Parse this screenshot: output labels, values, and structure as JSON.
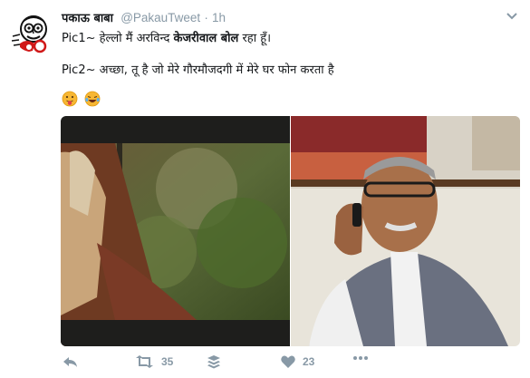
{
  "tweet": {
    "display_name": "पकाऊ बाबा",
    "handle": "@PakauTweet",
    "separator": "·",
    "time": "1h",
    "line1_before": "Pic1~ हेल्लो मैं अरविन्द ",
    "line1_bold": "केजरीवाल बोल",
    "line1_after": " रहा हूँ।",
    "line2": "Pic2~ अच्छा, तू है जो मेरे गौरमौजदगी में मेरे घर फोन करता है",
    "emojis": [
      "tongue-face-emoji",
      "laughing-tears-emoji"
    ]
  },
  "actions": {
    "retweet_count": "35",
    "like_count": "23"
  },
  "colors": {
    "action_gray": "#8899a6",
    "text": "#14171a"
  },
  "icons": [
    "pakau-avatar-icon",
    "caret-down-icon",
    "reply-icon",
    "retweet-icon",
    "buffer-icon",
    "like-heart-icon",
    "more-icon"
  ]
}
